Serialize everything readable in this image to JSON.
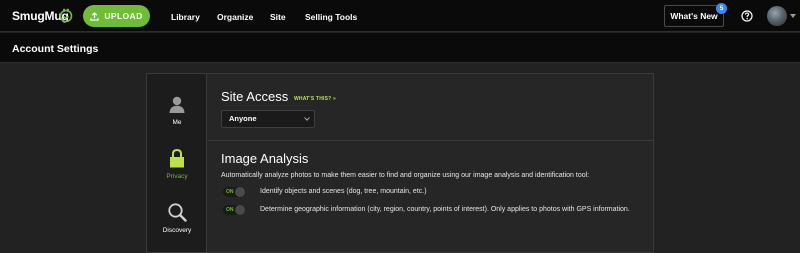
{
  "app": {
    "name": "SmugMug"
  },
  "toolbar": {
    "upload_label": "UPLOAD",
    "nav": [
      "Library",
      "Organize",
      "Site",
      "Selling Tools"
    ],
    "whats_new_label": "What's New",
    "whats_new_count": "5"
  },
  "page": {
    "title": "Account Settings"
  },
  "sidebar": {
    "items": [
      {
        "label": "Me",
        "icon": "person-icon",
        "active": false
      },
      {
        "label": "Privacy",
        "icon": "lock-icon",
        "active": true
      },
      {
        "label": "Discovery",
        "icon": "magnifier-icon",
        "active": false
      }
    ]
  },
  "site_access": {
    "heading": "Site Access",
    "whats_this": "WHAT'S THIS? »",
    "selected": "Anyone"
  },
  "image_analysis": {
    "heading": "Image Analysis",
    "description": "Automatically analyze photos to make them easier to find and organize using our image analysis and identification tool:",
    "options": [
      {
        "toggle_label": "ON",
        "text": "Identify objects and scenes (dog, tree, mountain, etc.)"
      },
      {
        "toggle_label": "ON",
        "text": "Determine geographic information (city, region, country, points of interest). Only applies to photos with GPS information."
      }
    ]
  },
  "colors": {
    "accent_green": "#6fbc37",
    "link_yellow": "#b8e34a",
    "badge_blue": "#3c8ce7",
    "topbar_bg": "#0a0a0a",
    "page_bg": "#222222"
  }
}
